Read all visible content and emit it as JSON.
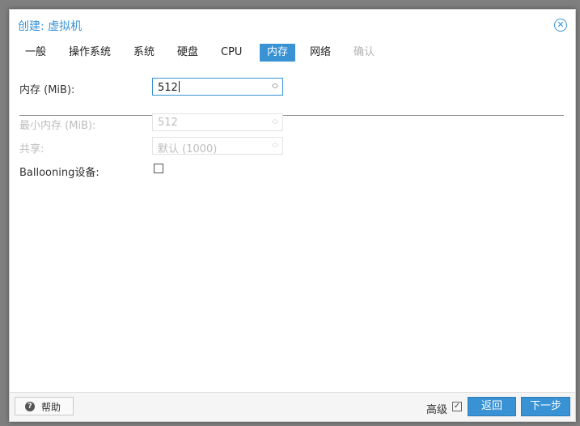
{
  "window": {
    "title": "创建: 虚拟机"
  },
  "tabs": [
    {
      "label": "一般"
    },
    {
      "label": "操作系统"
    },
    {
      "label": "系统"
    },
    {
      "label": "硬盘"
    },
    {
      "label": "CPU"
    },
    {
      "label": "内存",
      "active": true
    },
    {
      "label": "网络"
    },
    {
      "label": "确认",
      "disabled": true
    }
  ],
  "form": {
    "memory": {
      "label": "内存 (MiB):",
      "value": "512"
    },
    "min_memory": {
      "label": "最小内存 (MiB):",
      "value": "512",
      "disabled": true
    },
    "shares": {
      "label": "共享:",
      "value": "默认 (1000)",
      "disabled": true
    },
    "ballooning": {
      "label": "Ballooning设备:",
      "checked": false
    }
  },
  "footer": {
    "help_label": "帮助",
    "advanced_label": "高级",
    "advanced_checked": true,
    "back_label": "返回",
    "next_label": "下一步"
  },
  "colors": {
    "accent": "#3892d4",
    "backdrop": "#7f7f7f"
  },
  "icons": {
    "close": "close-circle-icon",
    "help": "question-circle-icon",
    "spinner": "chevron-up-down-icon"
  }
}
